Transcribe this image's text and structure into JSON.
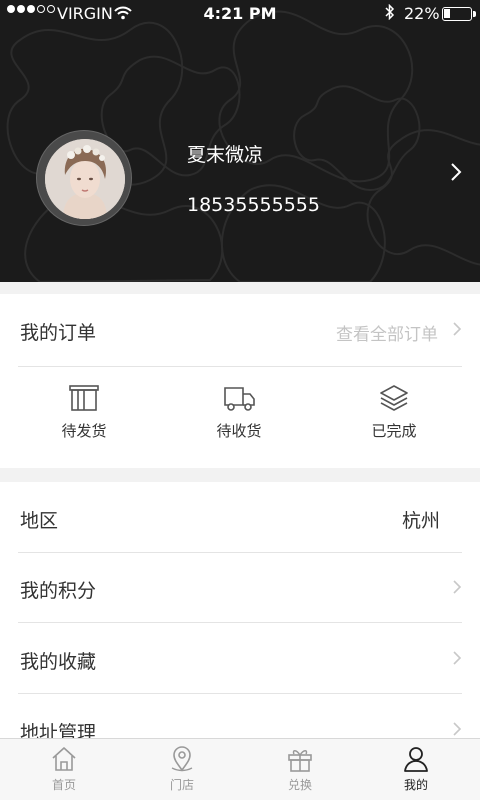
{
  "status_bar": {
    "carrier": "VIRGIN",
    "time": "4:21 PM",
    "battery": "22%"
  },
  "profile": {
    "name": "夏末微凉",
    "phone": "18535555555"
  },
  "orders": {
    "title": "我的订单",
    "view_all": "查看全部订单",
    "items": [
      {
        "label": "待发货",
        "icon": "package-icon"
      },
      {
        "label": "待收货",
        "icon": "truck-icon"
      },
      {
        "label": "已完成",
        "icon": "layers-icon"
      }
    ]
  },
  "menu": {
    "region_label": "地区",
    "region_value": "杭州",
    "points_label": "我的积分",
    "favorites_label": "我的收藏",
    "address_label": "地址管理"
  },
  "tabbar": {
    "tabs": [
      {
        "label": "首页",
        "icon": "home-icon",
        "active": false
      },
      {
        "label": "门店",
        "icon": "location-pin-icon",
        "active": false
      },
      {
        "label": "兑换",
        "icon": "gift-icon",
        "active": false
      },
      {
        "label": "我的",
        "icon": "user-icon",
        "active": true
      }
    ]
  }
}
